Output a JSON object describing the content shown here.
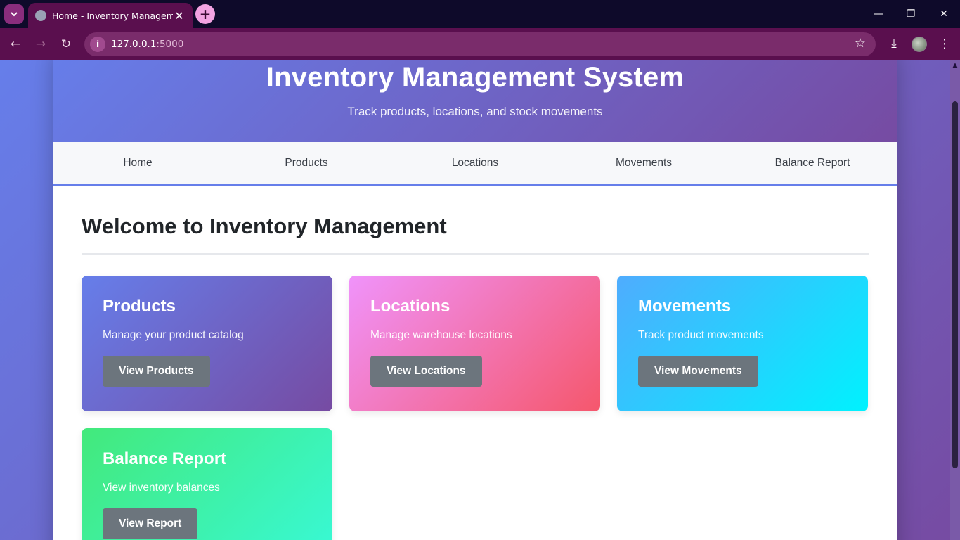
{
  "browser": {
    "tab_title": "Home - Inventory Management",
    "url_host": "127.0.0.1",
    "url_port": ":5000"
  },
  "header": {
    "title": "Inventory Management System",
    "subtitle": "Track products, locations, and stock movements"
  },
  "nav": {
    "items": [
      "Home",
      "Products",
      "Locations",
      "Movements",
      "Balance Report"
    ]
  },
  "main": {
    "heading": "Welcome to Inventory Management",
    "cards": [
      {
        "title": "Products",
        "description": "Manage your product catalog",
        "button": "View Products"
      },
      {
        "title": "Locations",
        "description": "Manage warehouse locations",
        "button": "View Locations"
      },
      {
        "title": "Movements",
        "description": "Track product movements",
        "button": "View Movements"
      },
      {
        "title": "Balance Report",
        "description": "View inventory balances",
        "button": "View Report"
      }
    ]
  },
  "colors": {
    "header_gradient": [
      "#667eea",
      "#764ba2"
    ],
    "products_gradient": [
      "#667eea",
      "#764ba2"
    ],
    "locations_gradient": [
      "#f093fb",
      "#f5576c"
    ],
    "movements_gradient": [
      "#4facfe",
      "#00f2fe"
    ],
    "balance_gradient": [
      "#43e97b",
      "#38f9d7"
    ],
    "button_bg": "#6c757d"
  }
}
